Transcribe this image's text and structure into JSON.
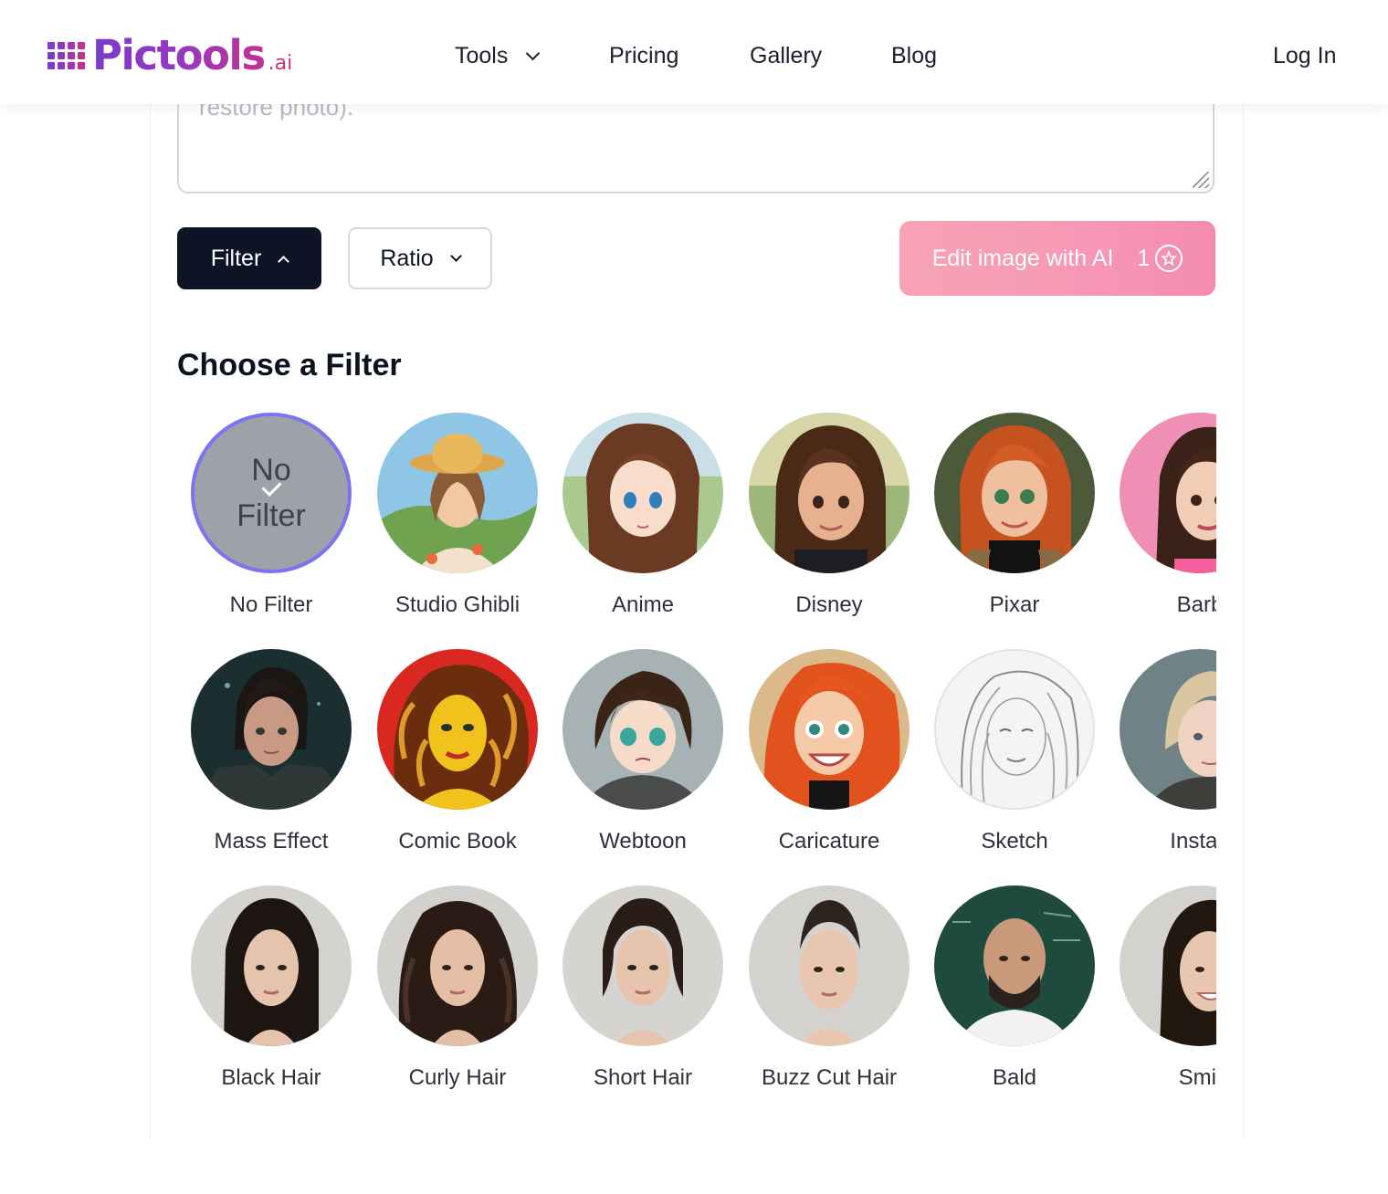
{
  "header": {
    "logo": "Pictools",
    "logo_suffix": ".ai",
    "nav": [
      {
        "label": "Tools",
        "has_dropdown": true
      },
      {
        "label": "Pricing"
      },
      {
        "label": "Gallery"
      },
      {
        "label": "Blog"
      }
    ],
    "login": "Log In",
    "colors": {
      "brand_purple": "#7a3cc9",
      "brand_pink": "#c8337f"
    }
  },
  "prompt": {
    "visible_text": "restore photo)."
  },
  "toolbar": {
    "filter_label": "Filter",
    "ratio_label": "Ratio",
    "edit_label": "Edit image with AI",
    "credit_cost": "1"
  },
  "section_title": "Choose a Filter",
  "selected_filter": "No Filter",
  "filters": [
    {
      "label": "No Filter",
      "overlay": [
        "No",
        "Filter"
      ],
      "selected": true
    },
    {
      "label": "Studio Ghibli"
    },
    {
      "label": "Anime"
    },
    {
      "label": "Disney"
    },
    {
      "label": "Pixar"
    },
    {
      "label": "Barb"
    },
    {
      "label": "Mass Effect"
    },
    {
      "label": "Comic Book"
    },
    {
      "label": "Webtoon"
    },
    {
      "label": "Caricature"
    },
    {
      "label": "Sketch"
    },
    {
      "label": "Instag"
    },
    {
      "label": "Black Hair"
    },
    {
      "label": "Curly Hair"
    },
    {
      "label": "Short Hair"
    },
    {
      "label": "Buzz Cut Hair"
    },
    {
      "label": "Bald"
    },
    {
      "label": "Smil"
    }
  ]
}
